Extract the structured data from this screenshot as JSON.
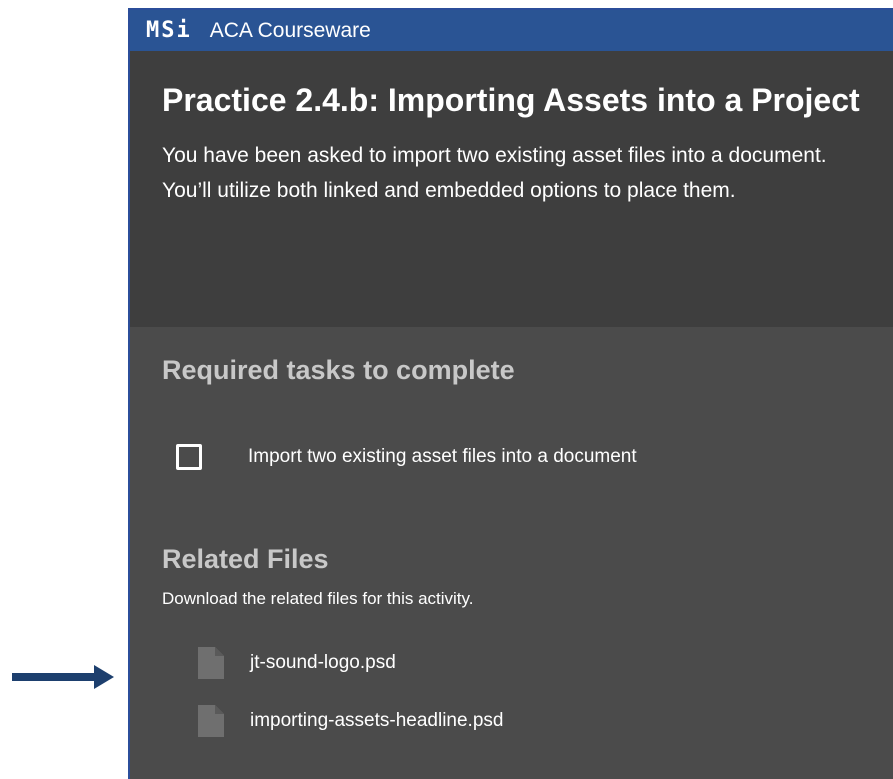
{
  "topbar": {
    "brand": "MSi",
    "app_name": "ACA Courseware"
  },
  "header": {
    "title": "Practice 2.4.b: Importing Assets into a Project",
    "description": "You have been asked to import two existing asset files into a document. You’ll utilize both linked and embedded options to place them."
  },
  "tasks": {
    "heading": "Required tasks to complete",
    "items": [
      {
        "label": "Import two existing asset files into a document",
        "checked": false
      }
    ]
  },
  "related": {
    "heading": "Related Files",
    "description": "Download the related files for this activity.",
    "files": [
      {
        "name": "jt-sound-logo.psd",
        "icon": "file-icon"
      },
      {
        "name": "importing-assets-headline.psd",
        "icon": "file-icon"
      }
    ]
  },
  "colors": {
    "topbar": "#2a5494",
    "header_bg": "#3e3e3e",
    "body_bg": "#4b4b4b",
    "arrow": "#1d3f6e"
  }
}
